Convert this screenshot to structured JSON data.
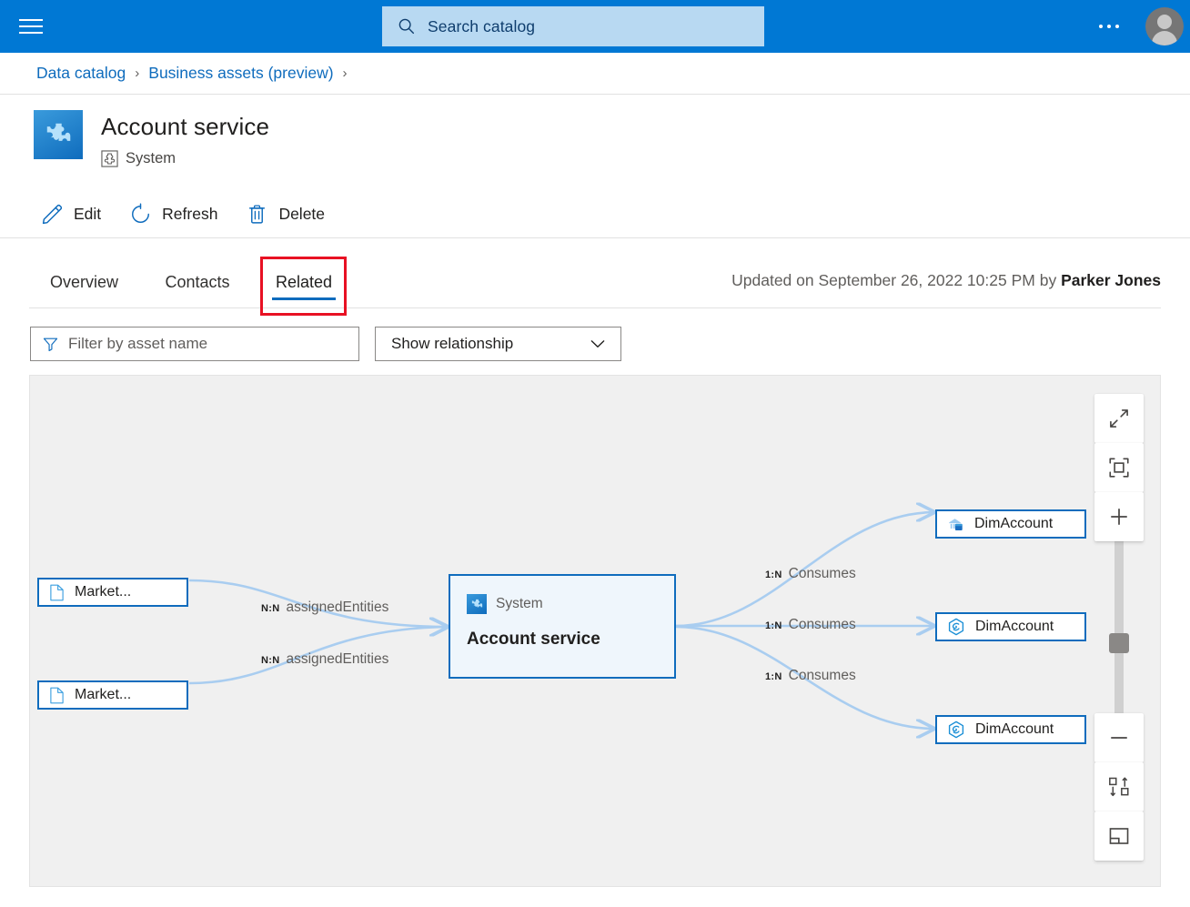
{
  "topbar": {
    "menu_icon": "hamburger-icon",
    "search": {
      "placeholder": "Search catalog",
      "icon": "search-icon"
    },
    "more_icon": "ellipsis-icon",
    "account_icon": "user-avatar-icon"
  },
  "breadcrumb": {
    "items": [
      {
        "label": "Data catalog"
      },
      {
        "label": "Business assets (preview)"
      }
    ],
    "separator": "›"
  },
  "page": {
    "icon": "system-puzzle-icon",
    "title": "Account service",
    "type_icon": "system-type-icon",
    "type_label": "System"
  },
  "commandbar": {
    "items": [
      {
        "label": "Edit",
        "icon": "pencil-icon"
      },
      {
        "label": "Refresh",
        "icon": "refresh-icon"
      },
      {
        "label": "Delete",
        "icon": "trash-icon"
      }
    ]
  },
  "tabs": {
    "items": [
      {
        "label": "Overview",
        "active": false
      },
      {
        "label": "Contacts",
        "active": false
      },
      {
        "label": "Related",
        "active": true
      }
    ],
    "highlight_color": "#e81123",
    "active_underline_color": "#0f6cbd"
  },
  "updated": {
    "prefix": "Updated on ",
    "datetime": "September 26, 2022 10:25 PM",
    "by": " by ",
    "user": "Parker Jones"
  },
  "filters": {
    "asset_filter": {
      "placeholder": "Filter by asset name",
      "value": "",
      "icon": "filter-icon"
    },
    "relationship_select": {
      "value": "Show relationship",
      "icon": "chevron-down-icon"
    }
  },
  "graph": {
    "nodes": [
      {
        "id": "market1",
        "label": "Market...",
        "icon": "document-icon",
        "kind": "left"
      },
      {
        "id": "market2",
        "label": "Market...",
        "icon": "document-icon",
        "kind": "left"
      },
      {
        "id": "center",
        "type_label": "System",
        "label": "Account service",
        "icon": "system-puzzle-icon",
        "kind": "center"
      },
      {
        "id": "dim1",
        "label": "DimAccount",
        "icon": "data-warehouse-icon",
        "kind": "right"
      },
      {
        "id": "dim2",
        "label": "DimAccount",
        "icon": "synapse-hex-icon",
        "kind": "right"
      },
      {
        "id": "dim3",
        "label": "DimAccount",
        "icon": "synapse-hex-icon",
        "kind": "right"
      }
    ],
    "edges": [
      {
        "cardinality": "N:N",
        "relationship": "assignedEntities"
      },
      {
        "cardinality": "N:N",
        "relationship": "assignedEntities"
      },
      {
        "cardinality": "1:N",
        "relationship": "Consumes"
      },
      {
        "cardinality": "1:N",
        "relationship": "Consumes"
      },
      {
        "cardinality": "1:N",
        "relationship": "Consumes"
      }
    ],
    "controls": [
      {
        "name": "expand-fullscreen-button",
        "icon": "diagonal-arrows-icon"
      },
      {
        "name": "fit-to-screen-button",
        "icon": "fit-frame-icon"
      },
      {
        "name": "zoom-in-button",
        "icon": "plus-icon"
      },
      {
        "name": "zoom-out-button",
        "icon": "minus-icon"
      },
      {
        "name": "swap-direction-button",
        "icon": "swap-updown-icon"
      },
      {
        "name": "toggle-panel-button",
        "icon": "layout-panel-icon"
      }
    ]
  },
  "colors": {
    "brand_blue": "#0078d4",
    "link_blue": "#0f6cbd",
    "node_border": "#0f6cbd",
    "center_fill": "#eff6fc",
    "edge_stroke": "#a9cdf0",
    "canvas": "#f0f0f0"
  }
}
